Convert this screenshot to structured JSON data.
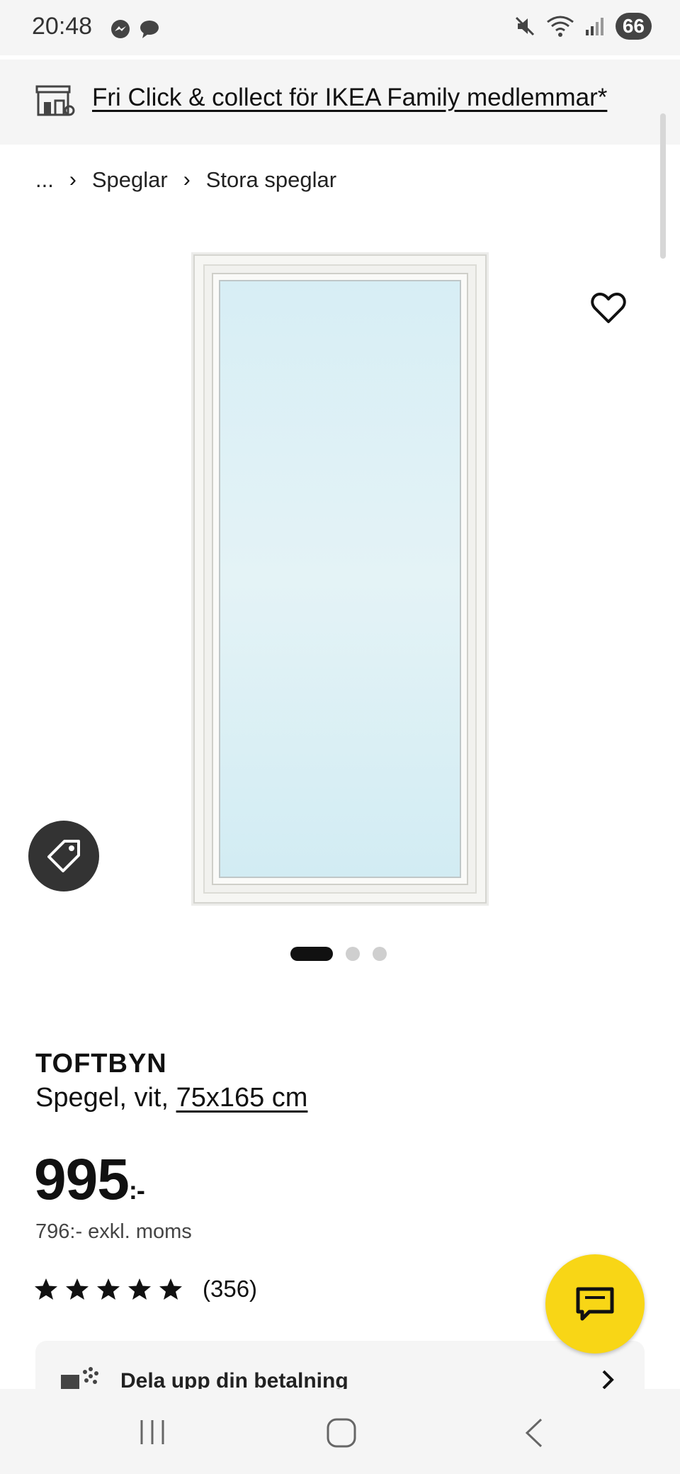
{
  "status_bar": {
    "time": "20:48",
    "battery": "66",
    "icons": [
      "messenger-icon",
      "chat-bubble-icon",
      "mute-icon",
      "wifi-icon",
      "signal-icon"
    ]
  },
  "promo": {
    "text": "Fri Click & collect för IKEA Family medlemmar*",
    "icon": "store-pickup-icon"
  },
  "breadcrumb": {
    "items": [
      "...",
      "Speglar",
      "Stora speglar"
    ]
  },
  "gallery": {
    "image_alt": "TOFTBYN Spegel, vit",
    "slide_count": 3,
    "active_slide": 1
  },
  "product": {
    "name": "TOFTBYN",
    "description": "Spegel, vit, ",
    "size": "75x165 cm",
    "price": "995",
    "price_suffix": ":-",
    "price_ex_vat": "796:- exkl. moms",
    "rating_stars": 5,
    "rating_count": "(356)"
  },
  "payment": {
    "label": "Dela upp din betalning"
  },
  "colors": {
    "accent_yellow": "#f8d616",
    "dark": "#111111",
    "panel_gray": "#f5f5f5"
  }
}
